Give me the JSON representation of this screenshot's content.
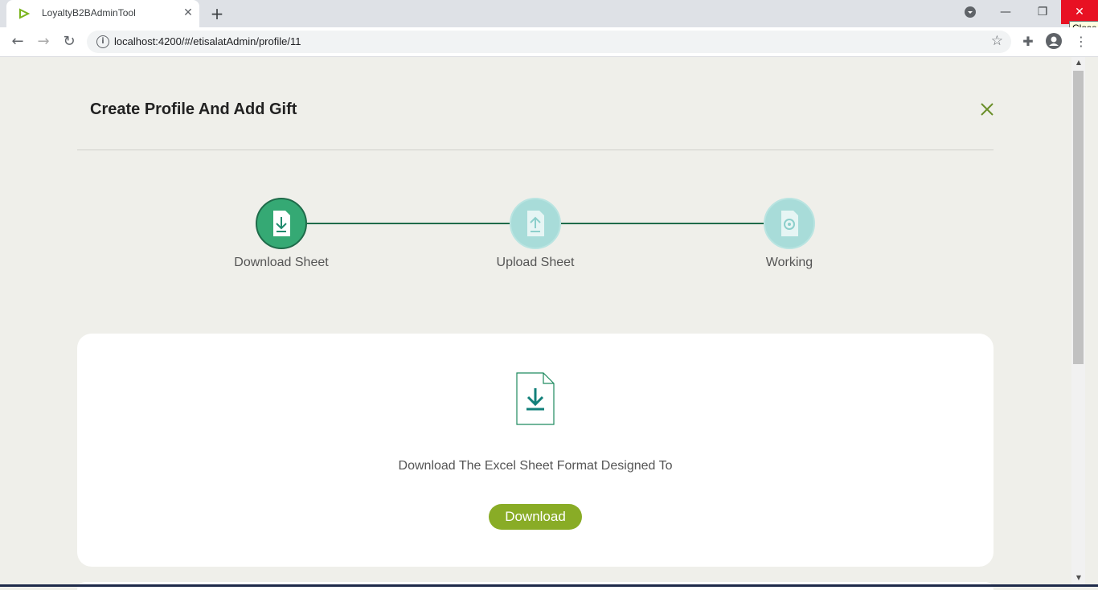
{
  "browser": {
    "tab_title": "LoyaltyB2BAdminTool",
    "url": "localhost:4200/#/etisalatAdmin/profile/11",
    "close_tooltip": "Close"
  },
  "modal": {
    "title": "Create Profile And Add Gift"
  },
  "stepper": {
    "steps": [
      {
        "label": "Download Sheet",
        "state": "active",
        "icon": "file-download-icon"
      },
      {
        "label": "Upload Sheet",
        "state": "inactive",
        "icon": "file-upload-icon"
      },
      {
        "label": "Working",
        "state": "inactive",
        "icon": "file-gear-icon"
      }
    ]
  },
  "card": {
    "message": "Download The Excel Sheet Format Designed To",
    "button_label": "Download"
  },
  "colors": {
    "active_step": "#35a974",
    "inactive_step": "#a8dcd9",
    "button": "#89ac26",
    "connector": "#1f6b4a"
  }
}
